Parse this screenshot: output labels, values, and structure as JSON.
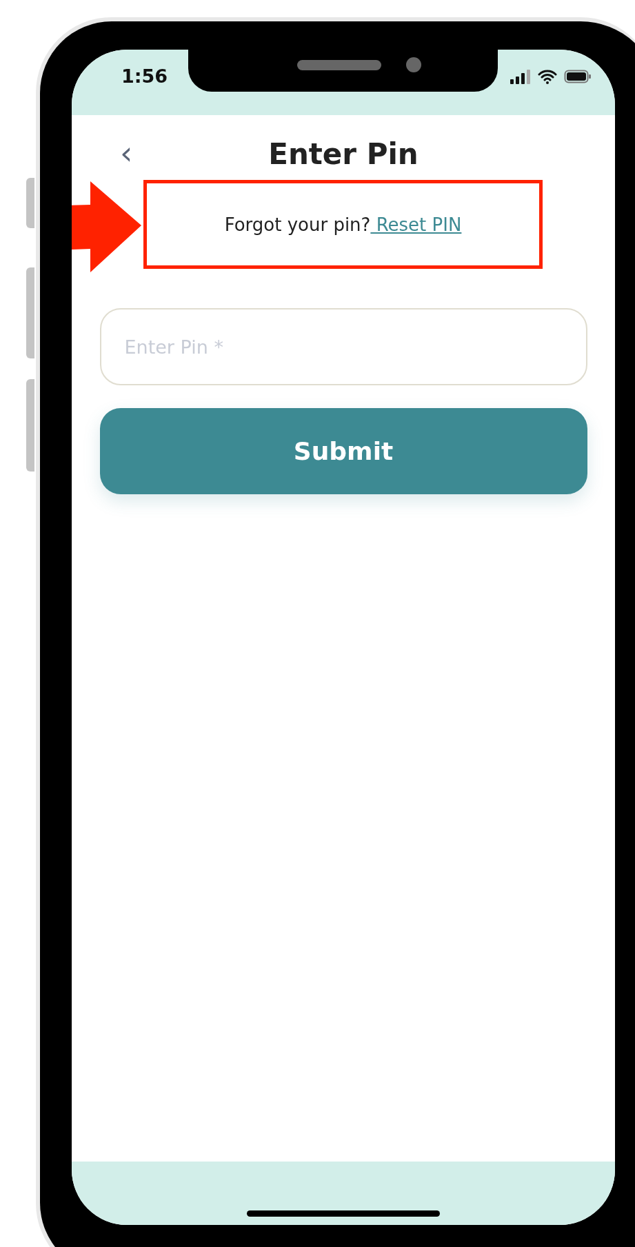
{
  "status_bar": {
    "time": "1:56"
  },
  "header": {
    "back": "‹",
    "title": "Enter Pin"
  },
  "prompt": {
    "text": "Forgot your pin?",
    "link": " Reset PIN"
  },
  "pin_field": {
    "placeholder": "Enter Pin *"
  },
  "submit_button": {
    "label": "Submit"
  }
}
